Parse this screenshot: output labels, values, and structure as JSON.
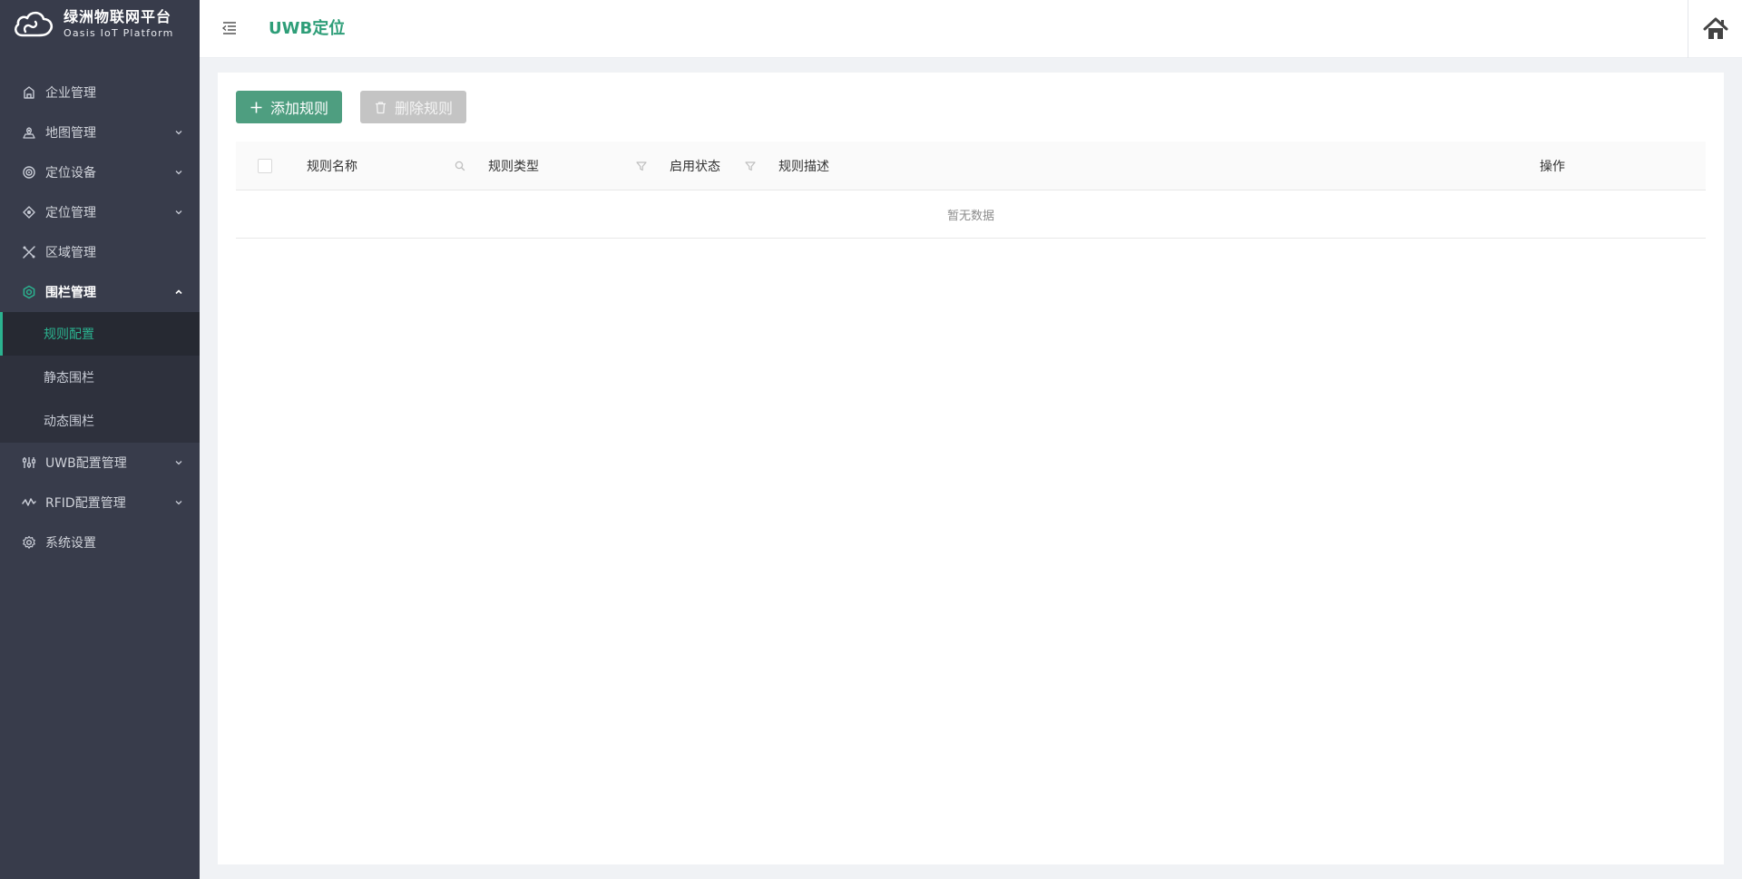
{
  "brand": {
    "title": "绿洲物联网平台",
    "subtitle": "Oasis IoT Platform"
  },
  "sidebar": {
    "items": [
      {
        "label": "企业管理",
        "icon": "building-icon",
        "expandable": false
      },
      {
        "label": "地图管理",
        "icon": "map-pin-icon",
        "expandable": true
      },
      {
        "label": "定位设备",
        "icon": "target-icon",
        "expandable": true
      },
      {
        "label": "定位管理",
        "icon": "crosshair-icon",
        "expandable": true
      },
      {
        "label": "区域管理",
        "icon": "area-tools-icon",
        "expandable": false
      },
      {
        "label": "围栏管理",
        "icon": "fence-hexagon-icon",
        "expandable": true,
        "open": true
      },
      {
        "label": "UWB配置管理",
        "icon": "sliders-icon",
        "expandable": true
      },
      {
        "label": "RFID配置管理",
        "icon": "signal-wave-icon",
        "expandable": true
      },
      {
        "label": "系统设置",
        "icon": "gear-icon",
        "expandable": false
      }
    ],
    "fence_submenu": [
      {
        "label": "规则配置",
        "active": true
      },
      {
        "label": "静态围栏",
        "active": false
      },
      {
        "label": "动态围栏",
        "active": false
      }
    ]
  },
  "header": {
    "title": "UWB定位"
  },
  "toolbar": {
    "add_label": "添加规则",
    "delete_label": "删除规则"
  },
  "table": {
    "columns": [
      "规则名称",
      "规则类型",
      "启用状态",
      "规则描述",
      "操作"
    ],
    "empty_text": "暂无数据"
  },
  "colors": {
    "sidebar_bg": "#383c4b",
    "accent": "#2bb390",
    "title": "#2e9e78",
    "add_button": "#4e9e80",
    "disabled_button": "#c4c4c4",
    "page_bg": "#f0f2f5"
  }
}
